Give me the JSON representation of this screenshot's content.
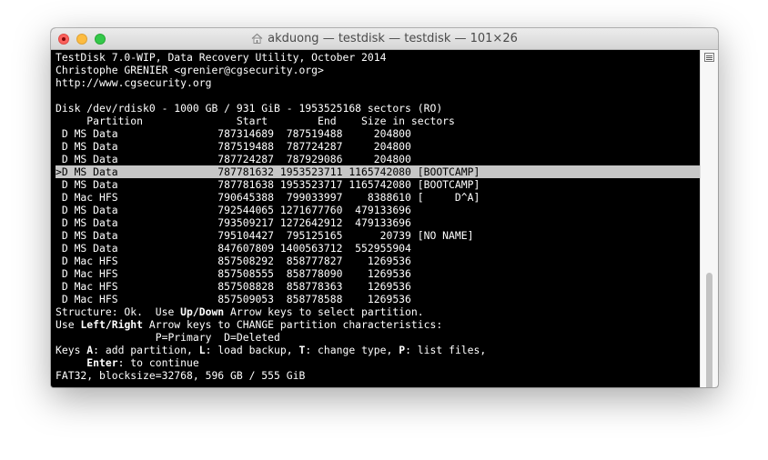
{
  "window": {
    "title": "akduong — testdisk — testdisk — 101×26",
    "title_icon": "home-icon"
  },
  "terminal": {
    "header": [
      "TestDisk 7.0-WIP, Data Recovery Utility, October 2014",
      "Christophe GRENIER <grenier@cgsecurity.org>",
      "http://www.cgsecurity.org"
    ],
    "disk_line": "Disk /dev/rdisk0 - 1000 GB / 931 GiB - 1953525168 sectors (RO)",
    "table_header": "     Partition               Start        End    Size in sectors",
    "partitions": [
      " D MS Data                787314689  787519488     204800",
      " D MS Data                787519488  787724287     204800",
      " D MS Data                787724287  787929086     204800",
      ">D MS Data                787781632 1953523711 1165742080 [BOOTCAMP]",
      " D MS Data                787781638 1953523717 1165742080 [BOOTCAMP]",
      " D Mac HFS                790645388  799033997    8388610 [     D^A]",
      " D MS Data                792544065 1271677760  479133696",
      " D MS Data                793509217 1272642912  479133696",
      " D MS Data                795104427  795125165      20739 [NO NAME]",
      " D MS Data                847607809 1400563712  552955904",
      " D Mac HFS                857508292  858777827    1269536",
      " D Mac HFS                857508555  858778090    1269536",
      " D Mac HFS                857508828  858778363    1269536",
      " D Mac HFS                857509053  858778588    1269536"
    ],
    "selected_index": 3,
    "structure": {
      "pre": "Structure: Ok.  Use ",
      "key": "Up/Down",
      "post": " Arrow keys to select partition."
    },
    "arrow_help": {
      "pre": "Use ",
      "key": "Left/Right",
      "post": " Arrow keys to CHANGE partition characteristics:"
    },
    "legend": "                P=Primary  D=Deleted",
    "keys": {
      "p1": "Keys ",
      "k1": "A",
      "t1": ": add partition, ",
      "k2": "L",
      "t2": ": load backup, ",
      "k3": "T",
      "t3": ": change type, ",
      "k4": "P",
      "t4": ": list files,"
    },
    "enter": {
      "pre": "     ",
      "key": "Enter",
      "post": ": to continue"
    },
    "status": "FAT32, blocksize=32768, 596 GB / 555 GiB"
  },
  "colors": {
    "terminal_bg": "#000000",
    "terminal_fg": "#ffffff",
    "selection_bg": "#c7c7c7"
  }
}
